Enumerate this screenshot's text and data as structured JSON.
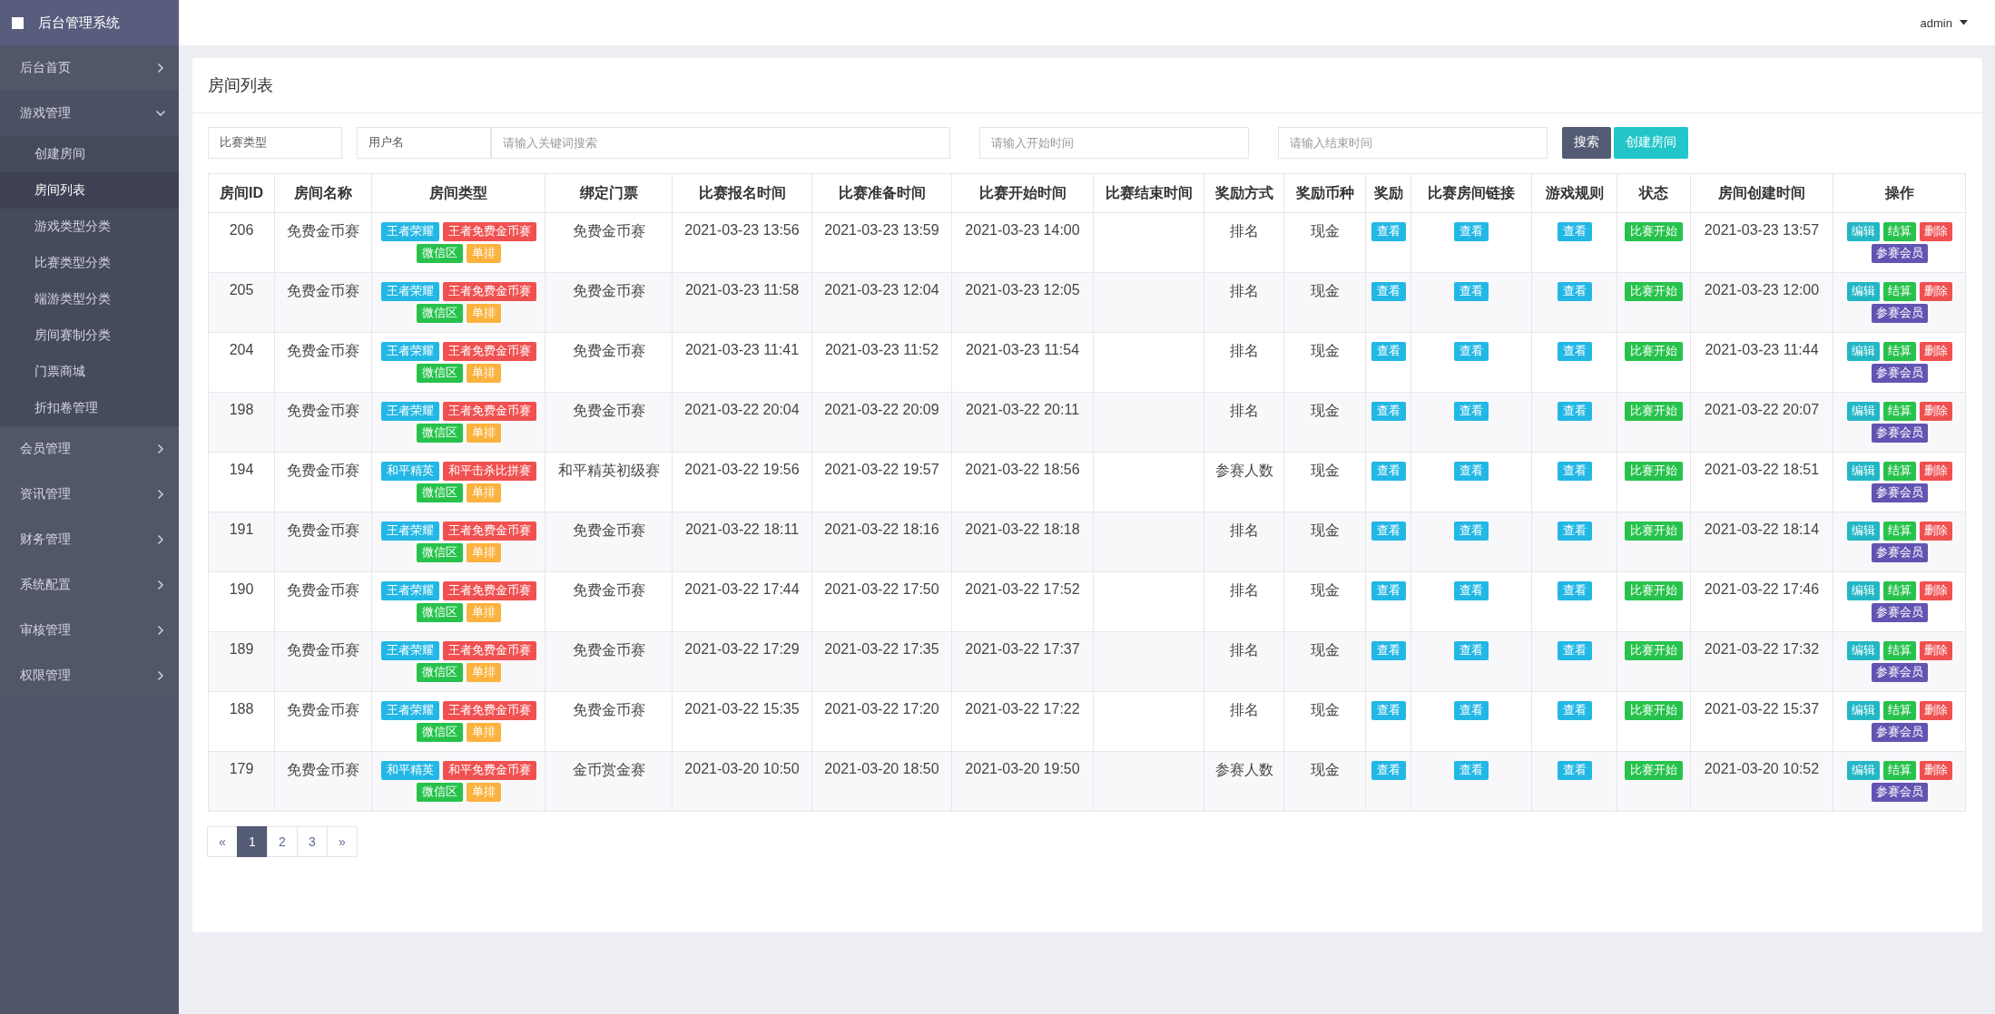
{
  "sidebar": {
    "title": "后台管理系统",
    "items": [
      {
        "label": "后台首页",
        "expanded": false
      },
      {
        "label": "游戏管理",
        "expanded": true,
        "children": [
          {
            "label": "创建房间",
            "selected": false
          },
          {
            "label": "房间列表",
            "selected": true
          },
          {
            "label": "游戏类型分类",
            "selected": false
          },
          {
            "label": "比赛类型分类",
            "selected": false
          },
          {
            "label": "端游类型分类",
            "selected": false
          },
          {
            "label": "房间赛制分类",
            "selected": false
          },
          {
            "label": "门票商城",
            "selected": false
          },
          {
            "label": "折扣卷管理",
            "selected": false
          }
        ]
      },
      {
        "label": "会员管理",
        "expanded": false
      },
      {
        "label": "资讯管理",
        "expanded": false
      },
      {
        "label": "财务管理",
        "expanded": false
      },
      {
        "label": "系统配置",
        "expanded": false
      },
      {
        "label": "审核管理",
        "expanded": false
      },
      {
        "label": "权限管理",
        "expanded": false
      }
    ]
  },
  "topbar": {
    "user": "admin"
  },
  "panel": {
    "title": "房间列表"
  },
  "filters": {
    "match_type": "比赛类型",
    "field": "用户名",
    "keyword_placeholder": "请输入关键词搜索",
    "start_placeholder": "请输入开始时间",
    "end_placeholder": "请输入结束时间",
    "search_button": "搜索",
    "create_button": "创建房间"
  },
  "table": {
    "columns": [
      "房间ID",
      "房间名称",
      "房间类型",
      "绑定门票",
      "比赛报名时间",
      "比赛准备时间",
      "比赛开始时间",
      "比赛结束时间",
      "奖励方式",
      "奖励币种",
      "奖励",
      "比赛房间链接",
      "游戏规则",
      "状态",
      "房间创建时间",
      "操作"
    ],
    "rows": [
      {
        "id": "206",
        "name": "免费金币赛",
        "tags": [
          {
            "label": "王者荣耀",
            "color": "#23b7e5"
          },
          {
            "label": "王者免费金币赛",
            "color": "#f05050"
          },
          {
            "label": "微信区",
            "color": "#27c24c"
          },
          {
            "label": "单排",
            "color": "#fbb23e"
          }
        ],
        "ticket": "免费金币赛",
        "signup": "2021-03-23 13:56",
        "prepare": "2021-03-23 13:59",
        "start": "2021-03-23 14:00",
        "reward_mode": "排名",
        "currency": "现金",
        "reward": "查看",
        "link": "查看",
        "rules": "查看",
        "status": "比赛开始",
        "created": "2021-03-23 13:57",
        "actions": [
          {
            "label": "编辑",
            "color": "#23b7c6"
          },
          {
            "label": "结算",
            "color": "#27c24c"
          },
          {
            "label": "删除",
            "color": "#f05050"
          },
          {
            "label": "参赛会员",
            "color": "#6254b2"
          }
        ]
      },
      {
        "id": "205",
        "name": "免费金币赛",
        "tags": [
          {
            "label": "王者荣耀",
            "color": "#23b7e5"
          },
          {
            "label": "王者免费金币赛",
            "color": "#f05050"
          },
          {
            "label": "微信区",
            "color": "#27c24c"
          },
          {
            "label": "单排",
            "color": "#fbb23e"
          }
        ],
        "ticket": "免费金币赛",
        "signup": "2021-03-23 11:58",
        "prepare": "2021-03-23 12:04",
        "start": "2021-03-23 12:05",
        "reward_mode": "排名",
        "currency": "现金",
        "reward": "查看",
        "link": "查看",
        "rules": "查看",
        "status": "比赛开始",
        "created": "2021-03-23 12:00",
        "actions": [
          {
            "label": "编辑",
            "color": "#23b7c6"
          },
          {
            "label": "结算",
            "color": "#27c24c"
          },
          {
            "label": "删除",
            "color": "#f05050"
          },
          {
            "label": "参赛会员",
            "color": "#6254b2"
          }
        ]
      },
      {
        "id": "204",
        "name": "免费金币赛",
        "tags": [
          {
            "label": "王者荣耀",
            "color": "#23b7e5"
          },
          {
            "label": "王者免费金币赛",
            "color": "#f05050"
          },
          {
            "label": "微信区",
            "color": "#27c24c"
          },
          {
            "label": "单排",
            "color": "#fbb23e"
          }
        ],
        "ticket": "免费金币赛",
        "signup": "2021-03-23 11:41",
        "prepare": "2021-03-23 11:52",
        "start": "2021-03-23 11:54",
        "reward_mode": "排名",
        "currency": "现金",
        "reward": "查看",
        "link": "查看",
        "rules": "查看",
        "status": "比赛开始",
        "created": "2021-03-23 11:44",
        "actions": [
          {
            "label": "编辑",
            "color": "#23b7c6"
          },
          {
            "label": "结算",
            "color": "#27c24c"
          },
          {
            "label": "删除",
            "color": "#f05050"
          },
          {
            "label": "参赛会员",
            "color": "#6254b2"
          }
        ]
      },
      {
        "id": "198",
        "name": "免费金币赛",
        "tags": [
          {
            "label": "王者荣耀",
            "color": "#23b7e5"
          },
          {
            "label": "王者免费金币赛",
            "color": "#f05050"
          },
          {
            "label": "微信区",
            "color": "#27c24c"
          },
          {
            "label": "单排",
            "color": "#fbb23e"
          }
        ],
        "ticket": "免费金币赛",
        "signup": "2021-03-22 20:04",
        "prepare": "2021-03-22 20:09",
        "start": "2021-03-22 20:11",
        "reward_mode": "排名",
        "currency": "现金",
        "reward": "查看",
        "link": "查看",
        "rules": "查看",
        "status": "比赛开始",
        "created": "2021-03-22 20:07",
        "actions": [
          {
            "label": "编辑",
            "color": "#23b7c6"
          },
          {
            "label": "结算",
            "color": "#27c24c"
          },
          {
            "label": "删除",
            "color": "#f05050"
          },
          {
            "label": "参赛会员",
            "color": "#6254b2"
          }
        ]
      },
      {
        "id": "194",
        "name": "免费金币赛",
        "tags": [
          {
            "label": "和平精英",
            "color": "#23b7e5"
          },
          {
            "label": "和平击杀比拼赛",
            "color": "#f05050"
          },
          {
            "label": "微信区",
            "color": "#27c24c"
          },
          {
            "label": "单排",
            "color": "#fbb23e"
          }
        ],
        "ticket": "和平精英初级赛",
        "signup": "2021-03-22 19:56",
        "prepare": "2021-03-22 19:57",
        "start": "2021-03-22 18:56",
        "reward_mode": "参赛人数",
        "currency": "现金",
        "reward": "查看",
        "link": "查看",
        "rules": "查看",
        "status": "比赛开始",
        "created": "2021-03-22 18:51",
        "actions": [
          {
            "label": "编辑",
            "color": "#23b7c6"
          },
          {
            "label": "结算",
            "color": "#27c24c"
          },
          {
            "label": "删除",
            "color": "#f05050"
          },
          {
            "label": "参赛会员",
            "color": "#6254b2"
          }
        ]
      },
      {
        "id": "191",
        "name": "免费金币赛",
        "tags": [
          {
            "label": "王者荣耀",
            "color": "#23b7e5"
          },
          {
            "label": "王者免费金币赛",
            "color": "#f05050"
          },
          {
            "label": "微信区",
            "color": "#27c24c"
          },
          {
            "label": "单排",
            "color": "#fbb23e"
          }
        ],
        "ticket": "免费金币赛",
        "signup": "2021-03-22 18:11",
        "prepare": "2021-03-22 18:16",
        "start": "2021-03-22 18:18",
        "reward_mode": "排名",
        "currency": "现金",
        "reward": "查看",
        "link": "查看",
        "rules": "查看",
        "status": "比赛开始",
        "created": "2021-03-22 18:14",
        "actions": [
          {
            "label": "编辑",
            "color": "#23b7c6"
          },
          {
            "label": "结算",
            "color": "#27c24c"
          },
          {
            "label": "删除",
            "color": "#f05050"
          },
          {
            "label": "参赛会员",
            "color": "#6254b2"
          }
        ]
      },
      {
        "id": "190",
        "name": "免费金币赛",
        "tags": [
          {
            "label": "王者荣耀",
            "color": "#23b7e5"
          },
          {
            "label": "王者免费金币赛",
            "color": "#f05050"
          },
          {
            "label": "微信区",
            "color": "#27c24c"
          },
          {
            "label": "单排",
            "color": "#fbb23e"
          }
        ],
        "ticket": "免费金币赛",
        "signup": "2021-03-22 17:44",
        "prepare": "2021-03-22 17:50",
        "start": "2021-03-22 17:52",
        "reward_mode": "排名",
        "currency": "现金",
        "reward": "查看",
        "link": "查看",
        "rules": "查看",
        "status": "比赛开始",
        "created": "2021-03-22 17:46",
        "actions": [
          {
            "label": "编辑",
            "color": "#23b7c6"
          },
          {
            "label": "结算",
            "color": "#27c24c"
          },
          {
            "label": "删除",
            "color": "#f05050"
          },
          {
            "label": "参赛会员",
            "color": "#6254b2"
          }
        ]
      },
      {
        "id": "189",
        "name": "免费金币赛",
        "tags": [
          {
            "label": "王者荣耀",
            "color": "#23b7e5"
          },
          {
            "label": "王者免费金币赛",
            "color": "#f05050"
          },
          {
            "label": "微信区",
            "color": "#27c24c"
          },
          {
            "label": "单排",
            "color": "#fbb23e"
          }
        ],
        "ticket": "免费金币赛",
        "signup": "2021-03-22 17:29",
        "prepare": "2021-03-22 17:35",
        "start": "2021-03-22 17:37",
        "reward_mode": "排名",
        "currency": "现金",
        "reward": "查看",
        "link": "查看",
        "rules": "查看",
        "status": "比赛开始",
        "created": "2021-03-22 17:32",
        "actions": [
          {
            "label": "编辑",
            "color": "#23b7c6"
          },
          {
            "label": "结算",
            "color": "#27c24c"
          },
          {
            "label": "删除",
            "color": "#f05050"
          },
          {
            "label": "参赛会员",
            "color": "#6254b2"
          }
        ]
      },
      {
        "id": "188",
        "name": "免费金币赛",
        "tags": [
          {
            "label": "王者荣耀",
            "color": "#23b7e5"
          },
          {
            "label": "王者免费金币赛",
            "color": "#f05050"
          },
          {
            "label": "微信区",
            "color": "#27c24c"
          },
          {
            "label": "单排",
            "color": "#fbb23e"
          }
        ],
        "ticket": "免费金币赛",
        "signup": "2021-03-22 15:35",
        "prepare": "2021-03-22 17:20",
        "start": "2021-03-22 17:22",
        "reward_mode": "排名",
        "currency": "现金",
        "reward": "查看",
        "link": "查看",
        "rules": "查看",
        "status": "比赛开始",
        "created": "2021-03-22 15:37",
        "actions": [
          {
            "label": "编辑",
            "color": "#23b7c6"
          },
          {
            "label": "结算",
            "color": "#27c24c"
          },
          {
            "label": "删除",
            "color": "#f05050"
          },
          {
            "label": "参赛会员",
            "color": "#6254b2"
          }
        ]
      },
      {
        "id": "179",
        "name": "免费金币赛",
        "tags": [
          {
            "label": "和平精英",
            "color": "#23b7e5"
          },
          {
            "label": "和平免费金币赛",
            "color": "#f05050"
          },
          {
            "label": "微信区",
            "color": "#27c24c"
          },
          {
            "label": "单排",
            "color": "#fbb23e"
          }
        ],
        "ticket": "金币赏金赛",
        "signup": "2021-03-20 10:50",
        "prepare": "2021-03-20 18:50",
        "start": "2021-03-20 19:50",
        "reward_mode": "参赛人数",
        "currency": "现金",
        "reward": "查看",
        "link": "查看",
        "rules": "查看",
        "status": "比赛开始",
        "created": "2021-03-20 10:52",
        "actions": [
          {
            "label": "编辑",
            "color": "#23b7c6"
          },
          {
            "label": "结算",
            "color": "#27c24c"
          },
          {
            "label": "删除",
            "color": "#f05050"
          },
          {
            "label": "参赛会员",
            "color": "#6254b2"
          }
        ]
      }
    ]
  },
  "pagination": {
    "prev": "«",
    "pages": [
      {
        "label": "1",
        "selected": true
      },
      {
        "label": "2",
        "selected": false
      },
      {
        "label": "3",
        "selected": false
      }
    ],
    "next": "»"
  }
}
